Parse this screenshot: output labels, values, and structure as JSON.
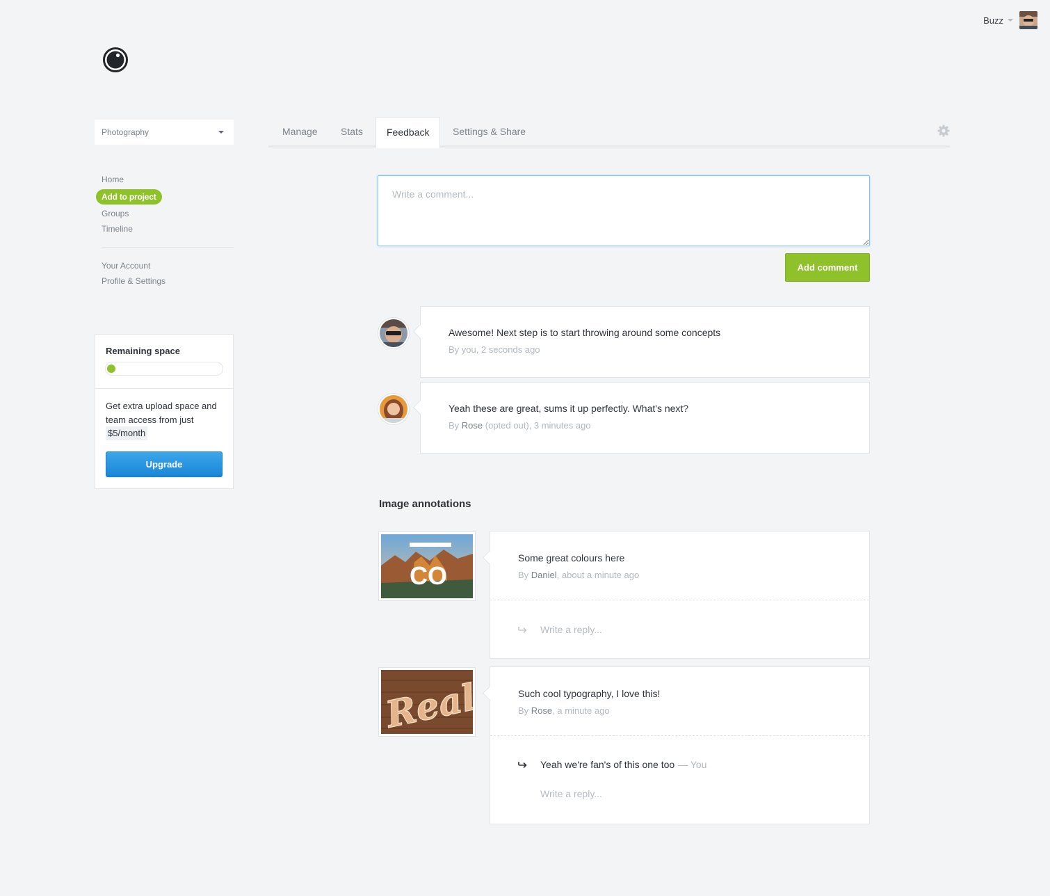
{
  "user": {
    "name": "Buzz"
  },
  "project_select": {
    "value": "Photography"
  },
  "nav": {
    "items": [
      {
        "label": "Home"
      },
      {
        "label": "Add to project"
      },
      {
        "label": "Groups"
      },
      {
        "label": "Timeline"
      }
    ],
    "account_items": [
      {
        "label": "Your Account"
      },
      {
        "label": "Profile & Settings"
      }
    ]
  },
  "space_card": {
    "title": "Remaining space",
    "used_fraction": 0.04,
    "promo": "Get extra upload space and team access from just",
    "price": "$5/month",
    "upgrade_label": "Upgrade"
  },
  "tabs": [
    {
      "label": "Manage"
    },
    {
      "label": "Stats"
    },
    {
      "label": "Feedback"
    },
    {
      "label": "Settings & Share"
    }
  ],
  "active_tab": "Feedback",
  "comment_box": {
    "placeholder": "Write a comment...",
    "button_label": "Add comment"
  },
  "comments": [
    {
      "text": "Awesome! Next step is to start throwing around some concepts",
      "meta_prefix": "By you, 2 seconds ago",
      "author": "",
      "meta_suffix": ""
    },
    {
      "text": "Yeah these are great, sums it up perfectly. What's next?",
      "meta_prefix": "By ",
      "author": "Rose",
      "meta_suffix": " (opted out), 3 minutes ago"
    }
  ],
  "annotations_title": "Image annotations",
  "annotations": [
    {
      "thumb_text": "CO",
      "text": "Some great colours here",
      "author": "Daniel",
      "time": ", about a minute ago",
      "replies": [],
      "reply_placeholder": "Write a reply..."
    },
    {
      "thumb_text": "Real",
      "text": "Such cool typography, I love this!",
      "author": "Rose",
      "time": ", a minute ago",
      "replies": [
        {
          "text": "Yeah we're fan's of this one too",
          "who": "— You"
        }
      ],
      "reply_placeholder": "Write a reply..."
    }
  ],
  "colors": {
    "accent_green": "#8fc12a",
    "upgrade_blue": "#1b86d6",
    "focus_blue": "#7cc7ee"
  },
  "icons": [
    "logo-icon",
    "caret-down-icon",
    "gear-icon",
    "reply-arrow-icon",
    "avatar"
  ]
}
